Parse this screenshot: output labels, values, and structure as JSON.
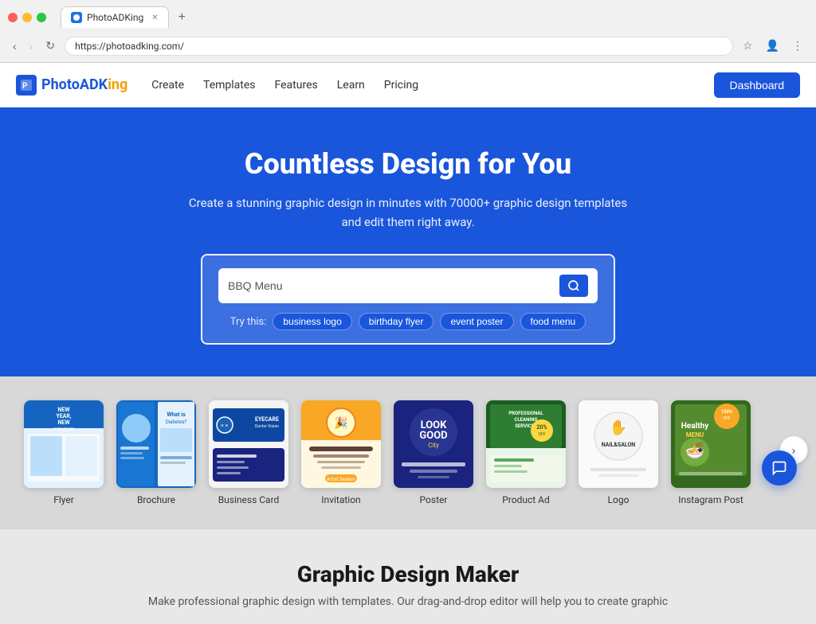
{
  "browser": {
    "url": "https://photoadking.com/",
    "tab_label": "PhotoADKing",
    "tab_favicon": "P"
  },
  "navbar": {
    "logo_text_part1": "PhotoADK",
    "logo_text_part2": "ing",
    "logo_icon": "P",
    "links": [
      {
        "label": "Create",
        "id": "create"
      },
      {
        "label": "Templates",
        "id": "templates"
      },
      {
        "label": "Features",
        "id": "features"
      },
      {
        "label": "Learn",
        "id": "learn"
      },
      {
        "label": "Pricing",
        "id": "pricing"
      }
    ],
    "dashboard_btn": "Dashboard"
  },
  "hero": {
    "title": "Countless Design for You",
    "subtitle": "Create a stunning graphic design in minutes with 70000+ graphic design templates and edit them right away.",
    "search_placeholder": "BBQ Menu",
    "search_value": "BBQ Menu",
    "try_this_label": "Try this:",
    "chips": [
      "business logo",
      "birthday flyer",
      "event poster",
      "food menu"
    ]
  },
  "templates": {
    "items": [
      {
        "label": "Flyer",
        "id": "flyer"
      },
      {
        "label": "Brochure",
        "id": "brochure"
      },
      {
        "label": "Business Card",
        "id": "bizcard"
      },
      {
        "label": "Invitation",
        "id": "invitation"
      },
      {
        "label": "Poster",
        "id": "poster"
      },
      {
        "label": "Product Ad",
        "id": "product"
      },
      {
        "label": "Logo",
        "id": "logo"
      },
      {
        "label": "Instagram Post",
        "id": "instagram"
      }
    ],
    "next_arrow": "›"
  },
  "bottom": {
    "title": "Graphic Design Maker",
    "subtitle": "Make professional graphic design with templates. Our drag-and-drop editor will help you to create graphic"
  },
  "chat_btn_icon": "💬"
}
